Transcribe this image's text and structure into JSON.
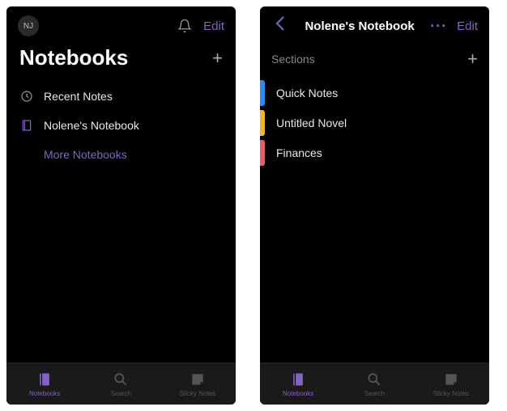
{
  "colors": {
    "accent": "#8661c5",
    "section_blue": "#2a8ef0",
    "section_yellow": "#f0b429",
    "section_red": "#e85d6b"
  },
  "left": {
    "avatar_initials": "NJ",
    "edit_label": "Edit",
    "title": "Notebooks",
    "items": {
      "recent": "Recent Notes",
      "notebook": "Nolene's Notebook",
      "more": "More Notebooks"
    }
  },
  "right": {
    "title": "Nolene's Notebook",
    "edit_label": "Edit",
    "sections_label": "Sections",
    "sections": [
      {
        "label": "Quick Notes",
        "color": "blue"
      },
      {
        "label": "Untitled Novel",
        "color": "yellow"
      },
      {
        "label": "Finances",
        "color": "red"
      }
    ]
  },
  "nav": {
    "notebooks": "Notebooks",
    "search": "Search",
    "sticky": "Sticky Notes"
  }
}
